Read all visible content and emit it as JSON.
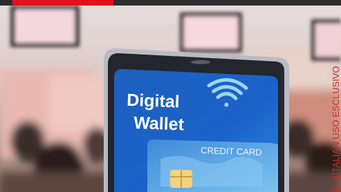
{
  "photo": {
    "phone_screen": {
      "title_line1": "Digital",
      "title_line2": "Wallet",
      "card_label": "CREDIT CARD"
    },
    "edge_text": "R. AITALIAN USO ESCLUSIVO",
    "colors": {
      "top_bar": "#2d2d2d",
      "accent_red": "#e0121b",
      "screen_blue": "#1b63c9",
      "card_blue": "#56a7e6"
    }
  }
}
